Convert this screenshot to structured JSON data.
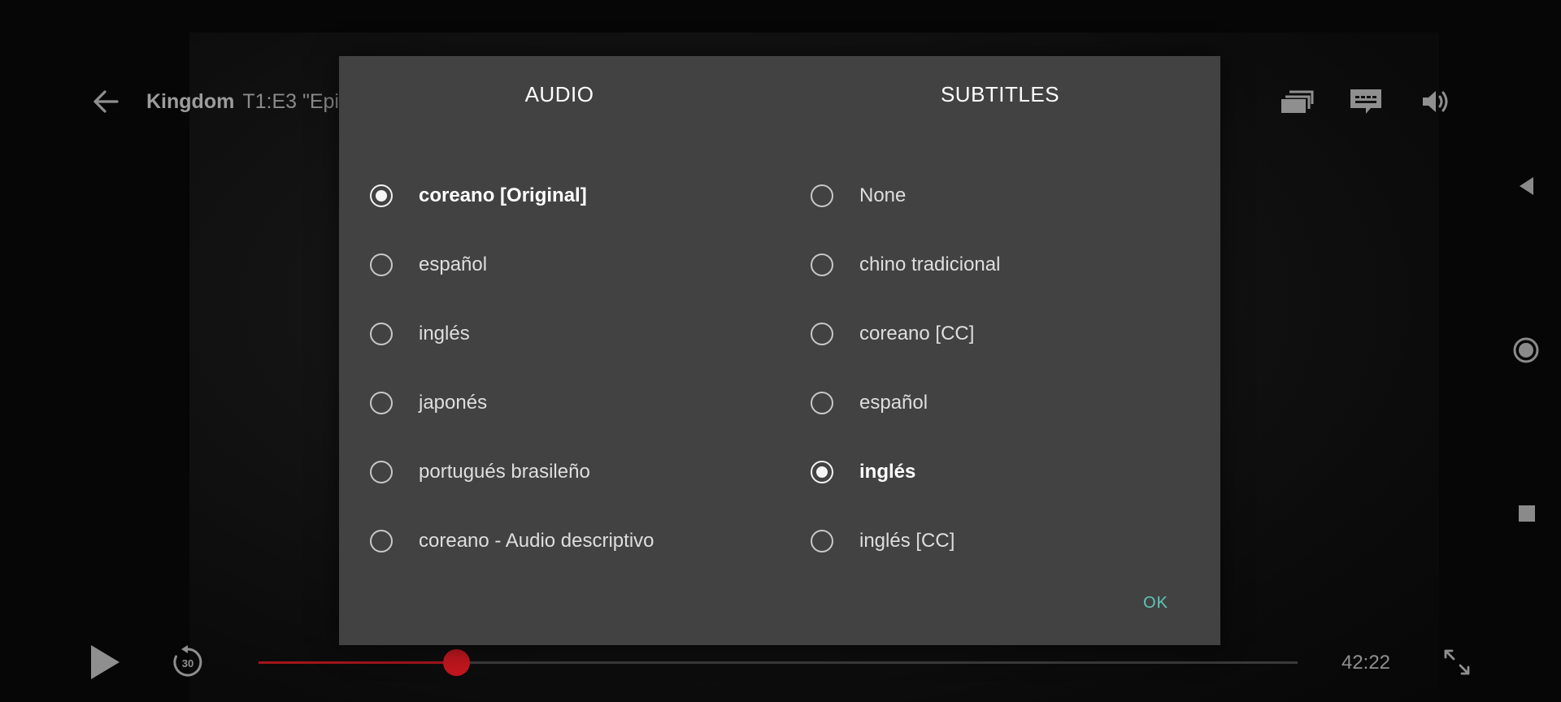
{
  "player": {
    "show_title": "Kingdom",
    "episode_title": "T1:E3 \"Epi",
    "time_remaining": "42:22",
    "progress": 0.19,
    "progress_color": "#a3141c",
    "icons": {
      "back": "arrow-left-icon",
      "episodes": "episodes-stack-icon",
      "subtitles": "subtitles-icon",
      "volume": "speaker-icon",
      "play": "play-icon",
      "rewind": "rewind-10-icon",
      "fullscreen": "fullscreen-icon"
    },
    "rewind_label": "30"
  },
  "system_nav": {
    "icons": [
      "nav-back-triangle-icon",
      "nav-home-circle-icon",
      "nav-recents-square-icon"
    ]
  },
  "dialog": {
    "audio": {
      "header": "AUDIO",
      "options": [
        {
          "label": "coreano [Original]",
          "selected": true
        },
        {
          "label": "español",
          "selected": false
        },
        {
          "label": "inglés",
          "selected": false
        },
        {
          "label": "japonés",
          "selected": false
        },
        {
          "label": "portugués brasileño",
          "selected": false
        },
        {
          "label": "coreano - Audio descriptivo",
          "selected": false
        }
      ]
    },
    "subtitles": {
      "header": "SUBTITLES",
      "options": [
        {
          "label": "None",
          "selected": false
        },
        {
          "label": "chino tradicional",
          "selected": false
        },
        {
          "label": "coreano [CC]",
          "selected": false
        },
        {
          "label": "español",
          "selected": false
        },
        {
          "label": "inglés",
          "selected": true
        },
        {
          "label": "inglés [CC]",
          "selected": false
        }
      ]
    },
    "ok_label": "OK",
    "ok_color": "#5fc7b7",
    "background": "#424242"
  }
}
